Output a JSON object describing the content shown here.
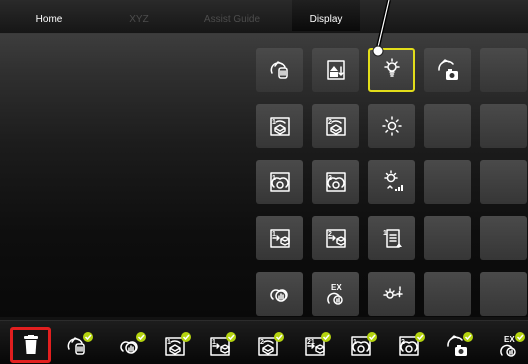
{
  "tabs": [
    {
      "label": "Home",
      "state": "normal"
    },
    {
      "label": "XYZ",
      "state": "disabled"
    },
    {
      "label": "Assist Guide",
      "state": "disabled"
    },
    {
      "label": "Display",
      "state": "active"
    }
  ],
  "colors": {
    "selection": "#e2dd1a",
    "delete_highlight": "#e21f1f",
    "check_badge": "#b5d40f"
  },
  "grid": {
    "tiles": [
      {
        "row": 1,
        "col": 1,
        "icon": "wb-hand-icon"
      },
      {
        "row": 1,
        "col": 2,
        "icon": "info-panel-icon"
      },
      {
        "row": 1,
        "col": 3,
        "icon": "bulb-icon",
        "selected": true
      },
      {
        "row": 1,
        "col": 4,
        "icon": "camera-hand-icon"
      },
      {
        "row": 1,
        "col": 5,
        "icon": "empty"
      },
      {
        "row": 2,
        "col": 1,
        "icon": "box-rotate-1-icon",
        "badge": "1"
      },
      {
        "row": 2,
        "col": 2,
        "icon": "box-rotate-2-icon",
        "badge": "2"
      },
      {
        "row": 2,
        "col": 3,
        "icon": "sparkle-icon"
      },
      {
        "row": 2,
        "col": 4,
        "icon": "empty"
      },
      {
        "row": 2,
        "col": 5,
        "icon": "empty"
      },
      {
        "row": 3,
        "col": 1,
        "icon": "double-circle-1-icon",
        "badge": "1"
      },
      {
        "row": 3,
        "col": 2,
        "icon": "double-circle-2-icon",
        "badge": "2"
      },
      {
        "row": 3,
        "col": 3,
        "icon": "bulb-bars-icon"
      },
      {
        "row": 3,
        "col": 4,
        "icon": "empty"
      },
      {
        "row": 3,
        "col": 5,
        "icon": "empty"
      },
      {
        "row": 4,
        "col": 1,
        "icon": "arrow-box-1-icon",
        "badge": "1"
      },
      {
        "row": 4,
        "col": 2,
        "icon": "arrow-box-2-icon",
        "badge": "2"
      },
      {
        "row": 4,
        "col": 3,
        "icon": "document-1-icon",
        "badge": "1"
      },
      {
        "row": 4,
        "col": 4,
        "icon": "empty"
      },
      {
        "row": 4,
        "col": 5,
        "icon": "empty"
      },
      {
        "row": 5,
        "col": 1,
        "icon": "double-circle-hand-icon"
      },
      {
        "row": 5,
        "col": 2,
        "icon": "ex-hand-icon",
        "badge": "EX"
      },
      {
        "row": 5,
        "col": 3,
        "icon": "bulb-plus-icon"
      },
      {
        "row": 5,
        "col": 4,
        "icon": "empty"
      },
      {
        "row": 5,
        "col": 5,
        "icon": "empty"
      }
    ]
  },
  "strip": {
    "items": [
      {
        "icon": "wb-hand-icon",
        "checked": true
      },
      {
        "icon": "double-circle-hand-icon",
        "checked": true
      },
      {
        "icon": "box-rotate-1-icon",
        "badge": "1",
        "checked": true
      },
      {
        "icon": "arrow-box-1-icon",
        "badge": "1",
        "checked": true
      },
      {
        "icon": "box-rotate-2-icon",
        "badge": "2",
        "checked": true
      },
      {
        "icon": "arrow-box-2-icon",
        "badge": "21",
        "checked": true
      },
      {
        "icon": "double-circle-1-icon",
        "badge": "1",
        "checked": true
      },
      {
        "icon": "double-circle-2-icon",
        "badge": "2",
        "checked": true
      },
      {
        "icon": "camera-hand-icon",
        "checked": true
      },
      {
        "icon": "ex-hand-icon",
        "badge": "EX",
        "checked": true
      }
    ]
  },
  "trash": {
    "icon": "trash-icon"
  }
}
